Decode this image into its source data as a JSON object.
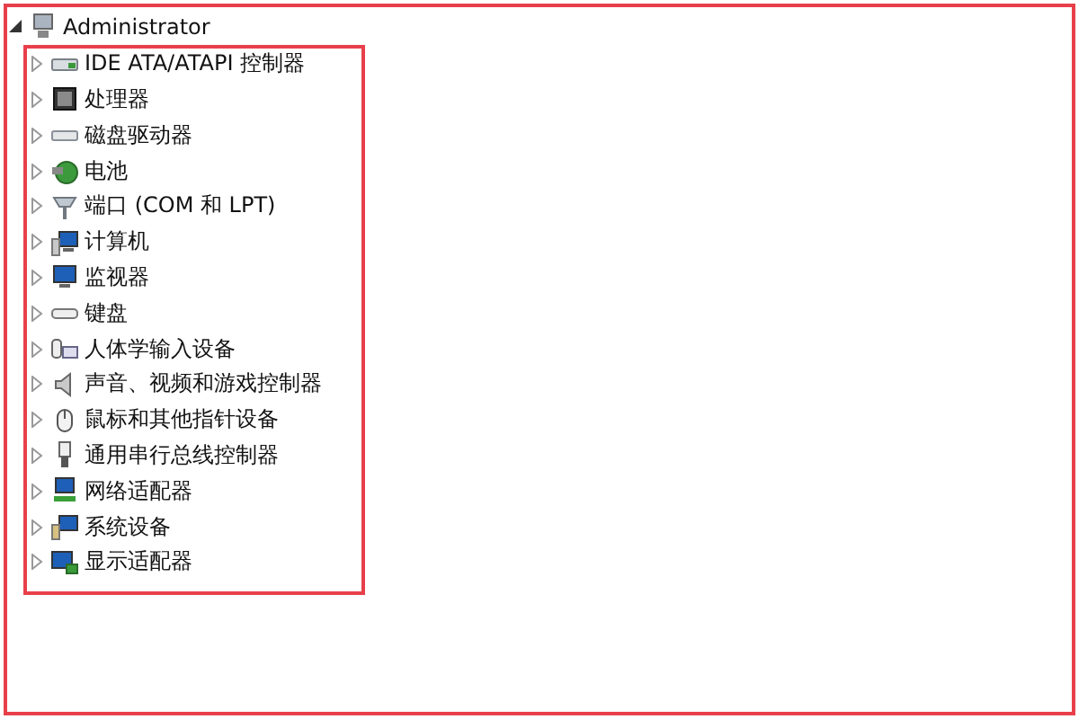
{
  "tree": {
    "label": "Administrator",
    "expanded": true,
    "children": [
      {
        "label": "IDE ATA/ATAPI 控制器",
        "expanded": false
      },
      {
        "label": "处理器",
        "expanded": false
      },
      {
        "label": "磁盘驱动器",
        "expanded": false
      },
      {
        "label": "电池",
        "expanded": false
      },
      {
        "label": "端口 (COM 和 LPT)",
        "expanded": false
      },
      {
        "label": "计算机",
        "expanded": false
      },
      {
        "label": "监视器",
        "expanded": false
      },
      {
        "label": "键盘",
        "expanded": false
      },
      {
        "label": "人体学输入设备",
        "expanded": false
      },
      {
        "label": "声音、视频和游戏控制器",
        "expanded": false
      },
      {
        "label": "鼠标和其他指针设备",
        "expanded": false
      },
      {
        "label": "通用串行总线控制器",
        "expanded": false
      },
      {
        "label": "网络适配器",
        "expanded": false
      },
      {
        "label": "系统设备",
        "expanded": false
      },
      {
        "label": "显示适配器",
        "expanded": false
      }
    ]
  }
}
